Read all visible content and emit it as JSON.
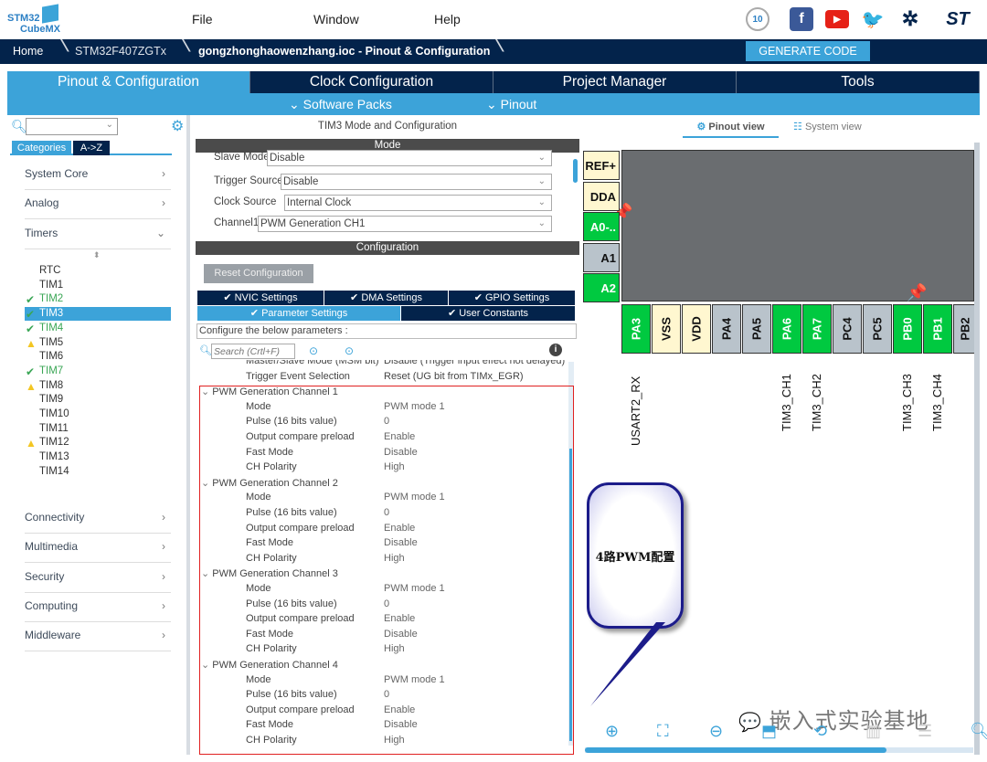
{
  "app": {
    "logo_line1": "STM32",
    "logo_line2": "CubeMX"
  },
  "menu": [
    "File",
    "Window",
    "Help"
  ],
  "social_icons": [
    "anniversary-badge-icon",
    "facebook-icon",
    "youtube-icon",
    "twitter-icon",
    "network-icon",
    "st-logo-icon"
  ],
  "breadcrumb": [
    "Home",
    "STM32F407ZGTx",
    "gongzhonghaowenzhang.ioc - Pinout & Configuration"
  ],
  "generate_code": "GENERATE CODE",
  "tabs": [
    "Pinout & Configuration",
    "Clock Configuration",
    "Project Manager",
    "Tools"
  ],
  "subtabs": [
    "Software Packs",
    "Pinout"
  ],
  "left": {
    "search_value": "",
    "view_tabs": [
      "Categories",
      "A->Z"
    ],
    "categories_top": [
      "System Core",
      "Analog",
      "Timers"
    ],
    "timers": [
      {
        "name": "RTC",
        "status": "none"
      },
      {
        "name": "TIM1",
        "status": "none"
      },
      {
        "name": "TIM2",
        "status": "ok"
      },
      {
        "name": "TIM3",
        "status": "selected"
      },
      {
        "name": "TIM4",
        "status": "ok"
      },
      {
        "name": "TIM5",
        "status": "warn"
      },
      {
        "name": "TIM6",
        "status": "none"
      },
      {
        "name": "TIM7",
        "status": "ok"
      },
      {
        "name": "TIM8",
        "status": "warn"
      },
      {
        "name": "TIM9",
        "status": "none"
      },
      {
        "name": "TIM10",
        "status": "none"
      },
      {
        "name": "TIM11",
        "status": "none"
      },
      {
        "name": "TIM12",
        "status": "warn"
      },
      {
        "name": "TIM13",
        "status": "none"
      },
      {
        "name": "TIM14",
        "status": "none"
      }
    ],
    "categories_bottom": [
      "Connectivity",
      "Multimedia",
      "Security",
      "Computing",
      "Middleware"
    ]
  },
  "mid": {
    "title": "TIM3 Mode and Configuration",
    "mode_header": "Mode",
    "mode_fields": [
      {
        "label": "Slave Mode",
        "value": "Disable"
      },
      {
        "label": "Trigger Source",
        "value": "Disable"
      },
      {
        "label": "Clock Source",
        "value": "Internal Clock"
      },
      {
        "label": "Channel1",
        "value": "PWM Generation CH1"
      }
    ],
    "config_header": "Configuration",
    "reset_button": "Reset Configuration",
    "config_tabs_row1": [
      "NVIC Settings",
      "DMA Settings",
      "GPIO Settings"
    ],
    "config_tabs_row2": [
      "Parameter Settings",
      "User Constants"
    ],
    "configure_hint": "Configure the below parameters :",
    "search_placeholder": "Search (Crtl+F)",
    "pre_rows": [
      {
        "label": "Master/Slave Mode (MSM bit)",
        "value": "Disable (Trigger input effect not delayed)"
      },
      {
        "label": "Trigger Event Selection",
        "value": "Reset (UG bit from TIMx_EGR)"
      }
    ],
    "channels": [
      {
        "title": "PWM Generation Channel 1",
        "rows": [
          [
            "Mode",
            "PWM mode 1"
          ],
          [
            "Pulse (16 bits value)",
            "0"
          ],
          [
            "Output compare preload",
            "Enable"
          ],
          [
            "Fast Mode",
            "Disable"
          ],
          [
            "CH Polarity",
            "High"
          ]
        ]
      },
      {
        "title": "PWM Generation Channel 2",
        "rows": [
          [
            "Mode",
            "PWM mode 1"
          ],
          [
            "Pulse (16 bits value)",
            "0"
          ],
          [
            "Output compare preload",
            "Enable"
          ],
          [
            "Fast Mode",
            "Disable"
          ],
          [
            "CH Polarity",
            "High"
          ]
        ]
      },
      {
        "title": "PWM Generation Channel 3",
        "rows": [
          [
            "Mode",
            "PWM mode 1"
          ],
          [
            "Pulse (16 bits value)",
            "0"
          ],
          [
            "Output compare preload",
            "Enable"
          ],
          [
            "Fast Mode",
            "Disable"
          ],
          [
            "CH Polarity",
            "High"
          ]
        ]
      },
      {
        "title": "PWM Generation Channel 4",
        "rows": [
          [
            "Mode",
            "PWM mode 1"
          ],
          [
            "Pulse (16 bits value)",
            "0"
          ],
          [
            "Output compare preload",
            "Enable"
          ],
          [
            "Fast Mode",
            "Disable"
          ],
          [
            "CH Polarity",
            "High"
          ]
        ]
      }
    ]
  },
  "right": {
    "view_tabs": [
      "Pinout view",
      "System view"
    ],
    "left_pins": [
      {
        "name": "REF+",
        "kind": "power"
      },
      {
        "name": "DDA",
        "kind": "power"
      },
      {
        "name": "A0-..",
        "kind": "used"
      },
      {
        "name": "A1",
        "kind": "free"
      },
      {
        "name": "A2",
        "kind": "used"
      }
    ],
    "bottom_pins": [
      {
        "name": "PA3",
        "kind": "used",
        "signal": "USART2_RX"
      },
      {
        "name": "VSS",
        "kind": "power",
        "signal": ""
      },
      {
        "name": "VDD",
        "kind": "power",
        "signal": ""
      },
      {
        "name": "PA4",
        "kind": "free",
        "signal": ""
      },
      {
        "name": "PA5",
        "kind": "free",
        "signal": ""
      },
      {
        "name": "PA6",
        "kind": "used",
        "signal": "TIM3_CH1"
      },
      {
        "name": "PA7",
        "kind": "used",
        "signal": "TIM3_CH2"
      },
      {
        "name": "PC4",
        "kind": "free",
        "signal": ""
      },
      {
        "name": "PC5",
        "kind": "free",
        "signal": ""
      },
      {
        "name": "PB0",
        "kind": "used",
        "signal": "TIM3_CH3"
      },
      {
        "name": "PB1",
        "kind": "used",
        "signal": "TIM3_CH4"
      },
      {
        "name": "PB2",
        "kind": "free",
        "signal": ""
      }
    ],
    "callout": "4路PWM配置",
    "watermark": "嵌入式实验基地",
    "tools": [
      "zoom-in-icon",
      "fit-screen-icon",
      "zoom-out-icon",
      "export-icon",
      "rotate-icon",
      "split-icon",
      "layers-icon",
      "search-icon"
    ]
  },
  "colors": {
    "navy": "#03234b",
    "accent": "#3ca3d9",
    "pin_used": "#00c940",
    "pin_power": "#fff7d0",
    "pin_free": "#b9c3cb",
    "ok": "#3aa655",
    "warn": "#f3c623",
    "highlight_box": "#e02020"
  }
}
